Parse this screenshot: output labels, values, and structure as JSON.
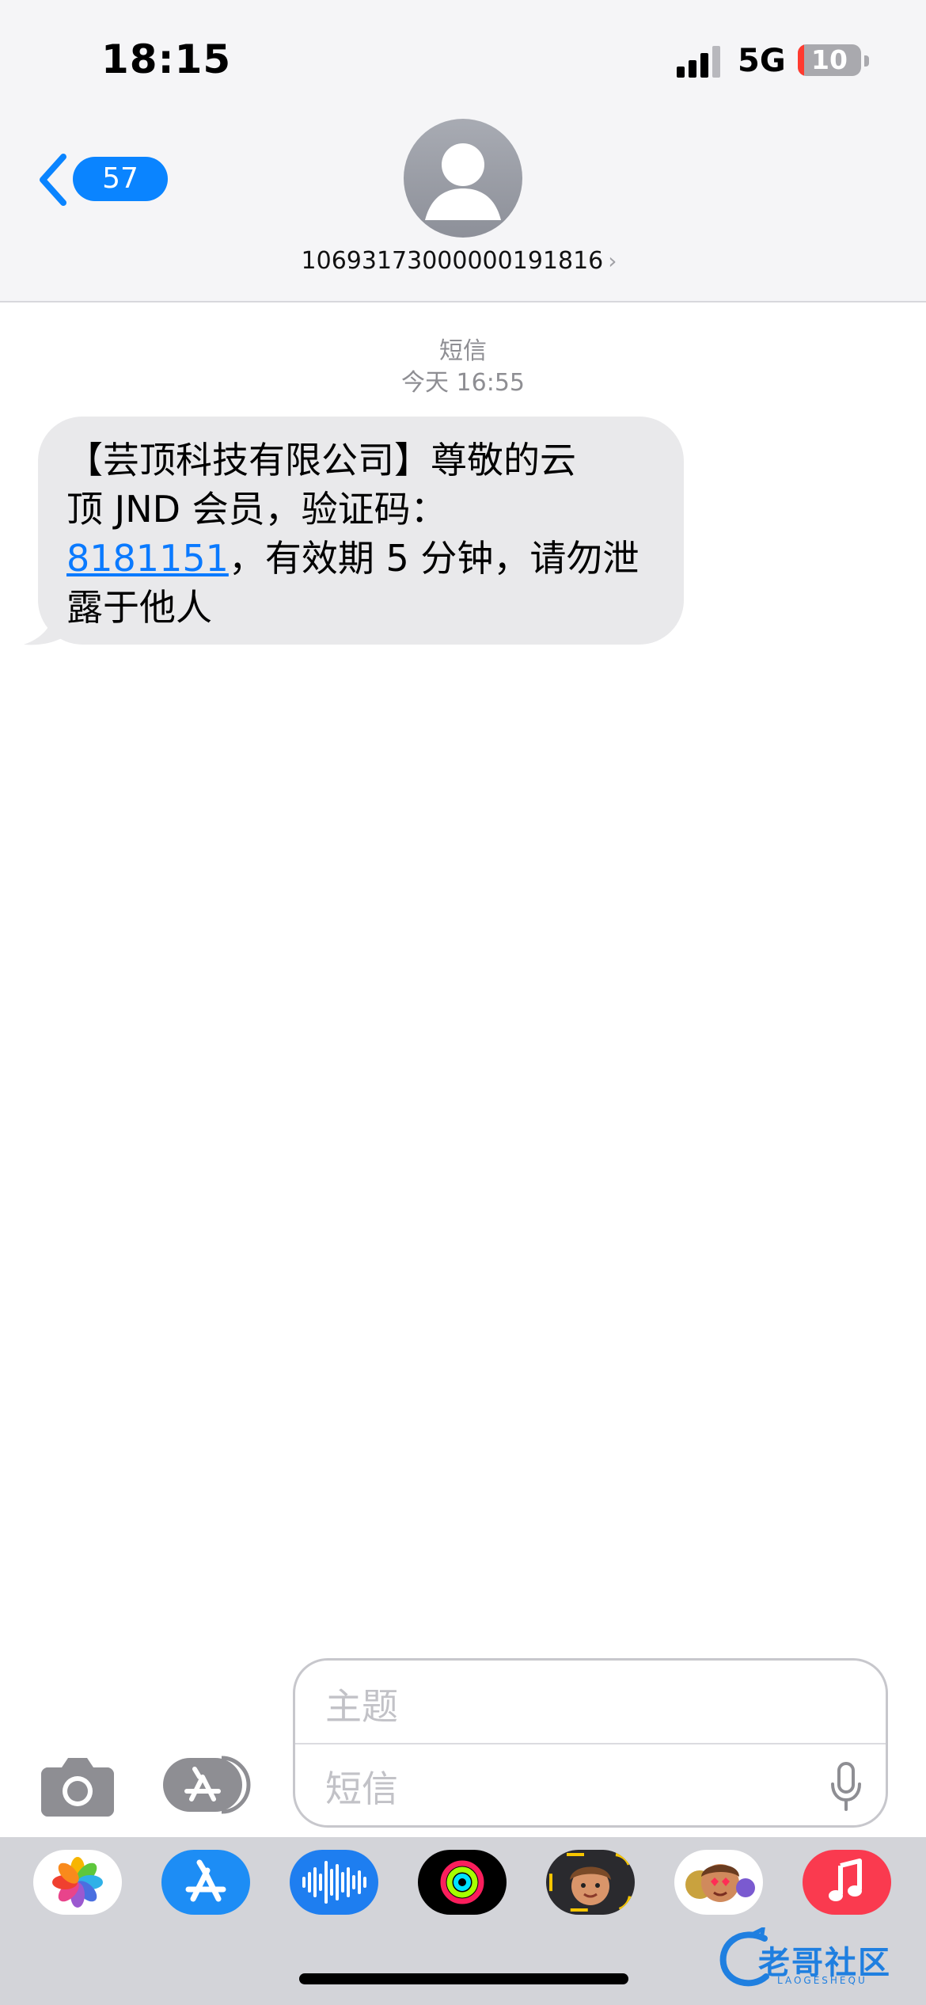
{
  "status_bar": {
    "time": "18:15",
    "network": "5G",
    "battery_level": "10",
    "battery_fraction": 0.1,
    "battery_color": "#ff3b30"
  },
  "nav": {
    "back_count": "57",
    "contact_number": "10693173000000191816",
    "accent_color": "#0a84ff"
  },
  "thread": {
    "message_type": "短信",
    "timestamp": "今天 16:55",
    "message": {
      "line1": "【芸顶科技有限公司】尊敬的云",
      "line2": "顶 JND 会员，验证码：",
      "code": "8181151",
      "line3_rest": "，有效期 5 分钟，请勿泄",
      "line4": "露于他人"
    }
  },
  "composer": {
    "subject_placeholder": "主题",
    "message_placeholder": "短信"
  },
  "app_drawer": {
    "apps": [
      "photos-icon",
      "app-store-icon",
      "audio-message-icon",
      "activity-icon",
      "memoji-icon",
      "memoji-stickers-icon",
      "music-icon"
    ]
  },
  "watermark": {
    "text": "老哥社区",
    "subtext": "LAOGESHEQU"
  }
}
